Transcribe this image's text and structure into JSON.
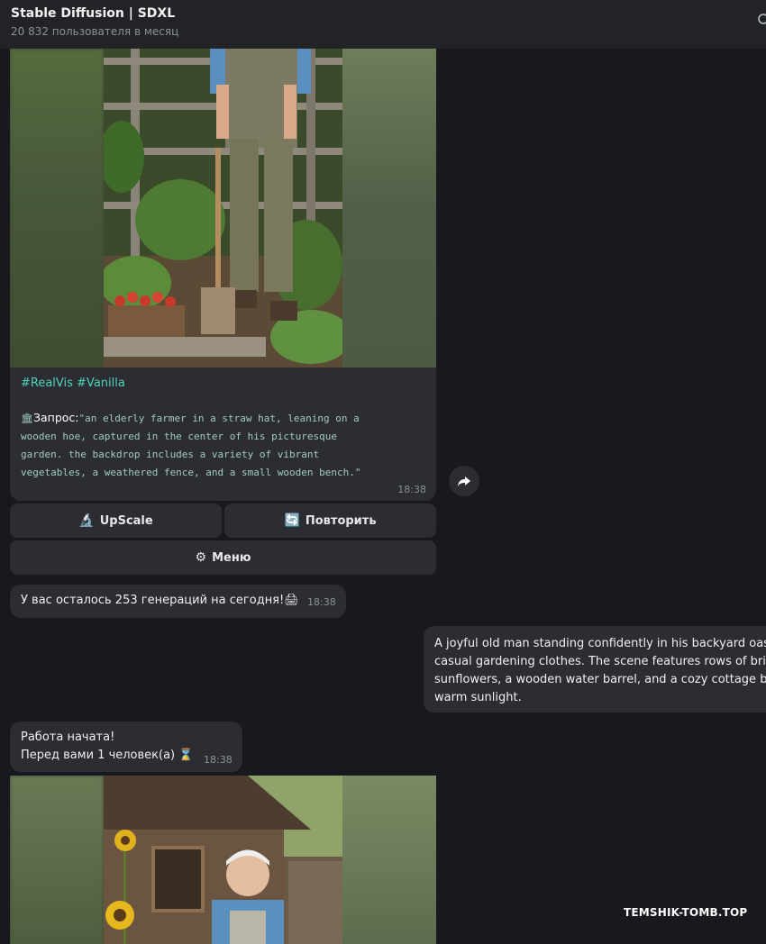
{
  "header": {
    "title": "Stable Diffusion | SDXL",
    "subtitle": "20 832 пользователя в месяц",
    "search_icon": "search-icon"
  },
  "messages": {
    "caption": {
      "tags": "#RealVis #Vanilla",
      "prompt_label": "Запрос:",
      "prompt_lines": [
        "\"an elderly farmer in a straw hat, leaning on a",
        "wooden hoe, captured in the center of his picturesque",
        "garden. the backdrop includes a variety of vibrant",
        "vegetables, a weathered fence, and a small wooden bench.\""
      ],
      "time": "18:38"
    },
    "keyboard": {
      "upscale": "UpScale",
      "repeat": "Повторить",
      "menu": "Меню"
    },
    "remaining": {
      "text": "У вас осталось 253 генераций на сегодня!",
      "time": "18:38"
    },
    "outgoing": {
      "lines": [
        "A joyful old man standing confidently in his backyard oas",
        "casual gardening clothes. The scene features rows of brig",
        "sunflowers, a wooden water barrel, and a cozy cottage b",
        "warm sunlight."
      ]
    },
    "status": {
      "line1": "Работа начата!",
      "line2": "Перед вами 1 человек(а)",
      "time": "18:38"
    }
  },
  "watermark": "TEMSHIK-TOMB.TOP",
  "colors": {
    "background": "#17191e",
    "bubble": "#2b2d33",
    "hashtag": "#4fd3b4",
    "code": "#a4ccbc"
  }
}
